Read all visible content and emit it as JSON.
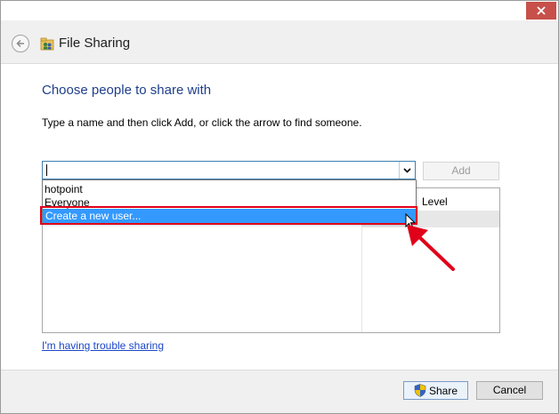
{
  "window": {
    "title": "File Sharing",
    "close_icon": "close-icon",
    "back_icon": "back-arrow-icon",
    "app_icon": "file-sharing-icon"
  },
  "main": {
    "heading": "Choose people to share with",
    "instruction": "Type a name and then click Add, or click the arrow to find someone.",
    "combo": {
      "value": "",
      "dropdown_icon": "chevron-down-icon"
    },
    "add_label": "Add",
    "list": {
      "column_level": "Level"
    },
    "dropdown_items": [
      "hotpoint",
      "Everyone",
      "Create a new user..."
    ],
    "trouble_link": "I'm having trouble sharing"
  },
  "footer": {
    "share_label": "Share",
    "share_icon": "uac-shield-icon",
    "cancel_label": "Cancel"
  },
  "colors": {
    "heading": "#1e3e8c",
    "selection": "#3399ff",
    "annotation": "#e0001a",
    "link": "#1a46c8"
  }
}
